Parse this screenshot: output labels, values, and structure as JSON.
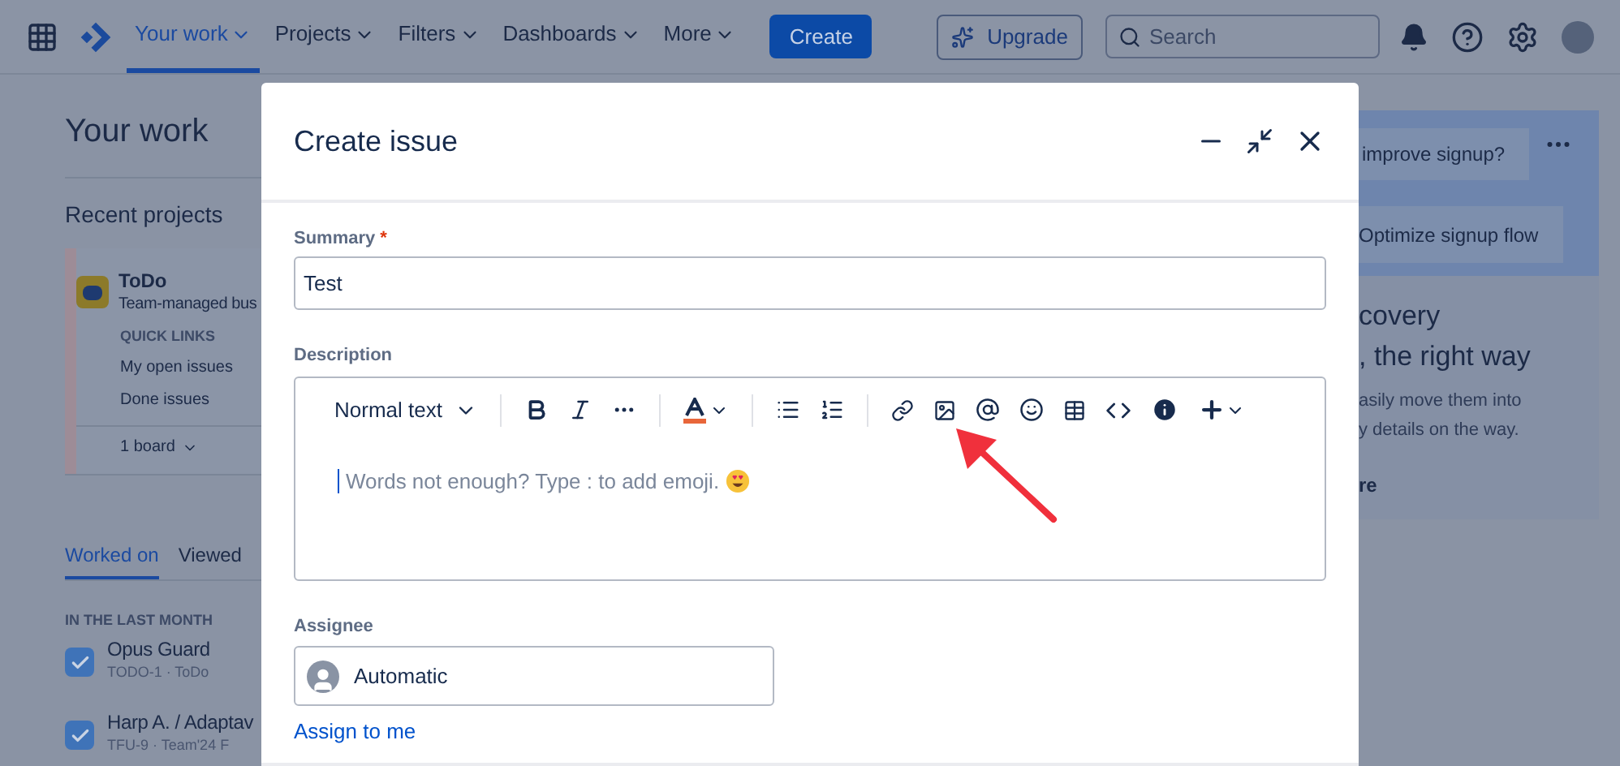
{
  "nav": {
    "items": [
      {
        "label": "Your work",
        "selected": true
      },
      {
        "label": "Projects",
        "selected": false
      },
      {
        "label": "Filters",
        "selected": false
      },
      {
        "label": "Dashboards",
        "selected": false
      },
      {
        "label": "More",
        "selected": false
      }
    ],
    "create": "Create",
    "upgrade": "Upgrade",
    "search": {
      "placeholder": "Search"
    }
  },
  "left": {
    "title": "Your work",
    "recent_heading": "Recent projects",
    "project": {
      "name": "ToDo",
      "type": "Team-managed bus",
      "quick_links_heading": "QUICK LINKS",
      "links": [
        "My open issues",
        "Done issues"
      ],
      "board": "1 board"
    },
    "tabs": [
      {
        "label": "Worked on",
        "selected": true
      },
      {
        "label": "Viewed",
        "selected": false
      }
    ],
    "section": "IN THE LAST MONTH",
    "issues": [
      {
        "title": "Opus Guard",
        "meta": "TODO-1 · ToDo",
        "checked": true
      },
      {
        "title": "Harp A. / Adaptav",
        "meta": "TFU-9 · Team'24 F",
        "checked": true
      }
    ]
  },
  "right": {
    "chips": [
      "improve signup?",
      "Optimize signup flow"
    ],
    "heading_lines": [
      "covery",
      ", the right way"
    ],
    "text_lines": [
      "asily move them into",
      "y details on the way."
    ],
    "link": "re"
  },
  "modal": {
    "title": "Create issue",
    "summary": {
      "label": "Summary",
      "required_marker": "*",
      "value": "Test"
    },
    "description": {
      "label": "Description",
      "text_style": "Normal text",
      "placeholder": "Words not enough? Type : to add emoji."
    },
    "assignee": {
      "label": "Assignee",
      "value": "Automatic",
      "assign_link": "Assign to me"
    }
  }
}
